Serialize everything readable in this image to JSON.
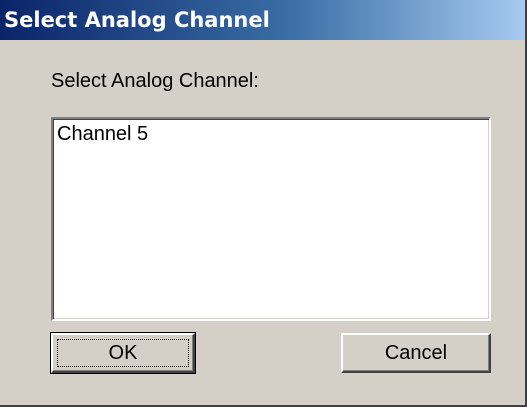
{
  "dialog": {
    "title": "Select Analog Channel",
    "prompt": "Select Analog Channel:",
    "list_items": [
      "Channel 5"
    ],
    "ok_label": "OK",
    "cancel_label": "Cancel"
  },
  "colors": {
    "titlebar_start": "#0a246a",
    "titlebar_end": "#a6caf0",
    "face": "#d4d0c8",
    "list_background": "#ffffff"
  }
}
